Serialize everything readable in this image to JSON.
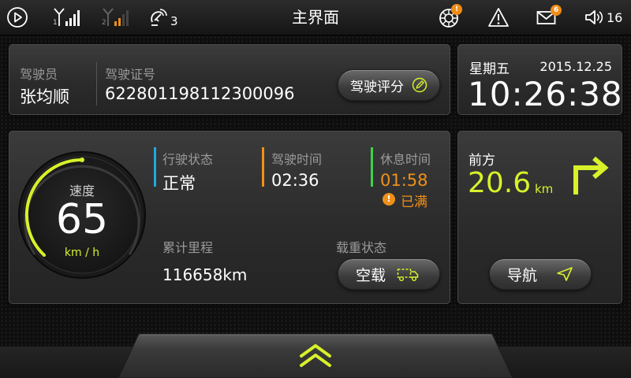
{
  "statusbar": {
    "title": "主界面",
    "signal1_index": "1",
    "signal2_index": "2",
    "satellite_count": "3",
    "alert_badge": "!",
    "message_count": "6",
    "volume_level": "16",
    "icons": [
      "play-circle-icon",
      "signal-1-icon",
      "signal-2-icon",
      "satellite-icon",
      "tire-icon",
      "warning-icon",
      "mail-icon",
      "volume-icon"
    ]
  },
  "driver": {
    "name_label": "驾驶员",
    "name": "张均顺",
    "license_label": "驾驶证号",
    "license": "622801198112300096",
    "rate_button": "驾驶评分"
  },
  "datetime": {
    "weekday": "星期五",
    "date": "2015.12.25",
    "time": "10:26:38"
  },
  "speed": {
    "label": "速度",
    "value": "65",
    "unit": "km / h"
  },
  "status": {
    "drive_status_label": "行驶状态",
    "drive_status": "正常",
    "drive_time_label": "驾驶时间",
    "drive_time": "02:36",
    "rest_time_label": "休息时间",
    "rest_time": "01:58",
    "rest_warning": "已满",
    "mileage_label": "累计里程",
    "mileage": "116658km",
    "load_label": "载重状态",
    "load_button": "空载"
  },
  "navigation": {
    "label": "前方",
    "distance": "20.6",
    "unit": "km",
    "button": "导航"
  },
  "colors": {
    "accent": "#d8f12a",
    "blue": "#1fa9e0",
    "orange": "#f0901a",
    "green": "#3ed24a",
    "warning": "#f0901a"
  }
}
